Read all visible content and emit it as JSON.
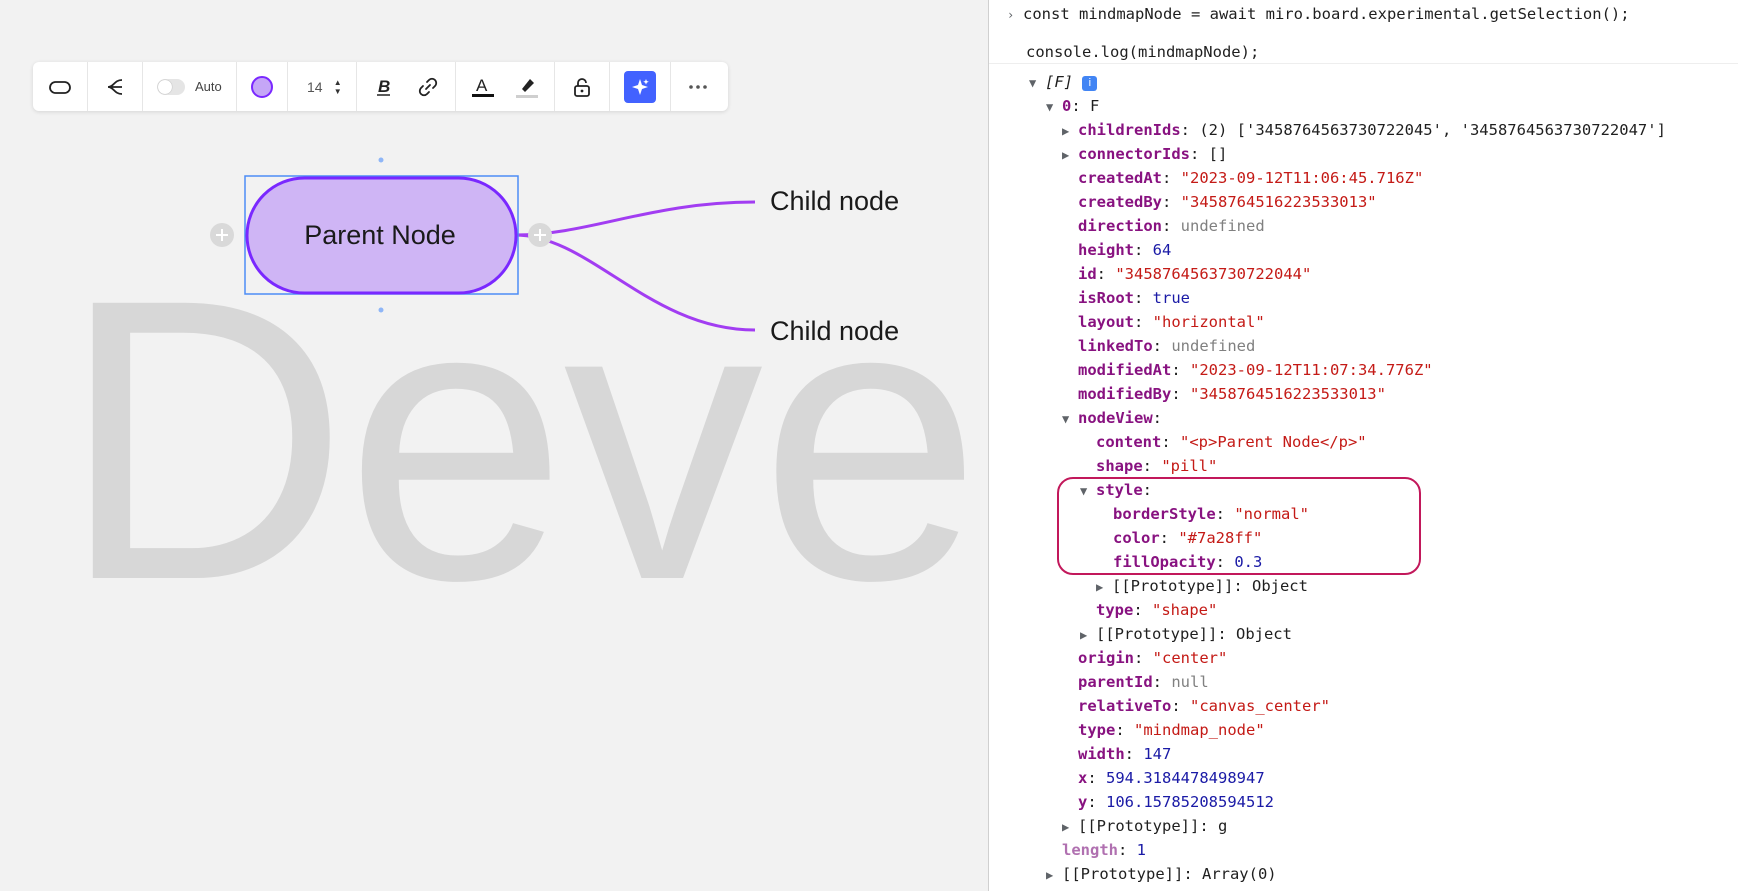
{
  "canvas": {
    "watermark": "Devel",
    "toolbar": {
      "auto_label": "Auto",
      "font_size": "14",
      "items": [
        "shape-icon",
        "mindmap-layout-icon",
        "auto-toggle",
        "color-picker",
        "font-size-stepper",
        "bold-icon",
        "link-icon",
        "text-color-icon",
        "highlighter-icon",
        "lock-icon",
        "ai-sparkle-icon",
        "more-icon"
      ]
    },
    "mindmap": {
      "parent_label": "Parent Node",
      "child_1_label": "Child node",
      "child_2_label": "Child node",
      "node_color": "#7a28ff",
      "node_fill": "#cfb5f5"
    }
  },
  "console": {
    "command_line_1": "const mindmapNode = await miro.board.experimental.getSelection();",
    "command_line_2": "console.log(mindmapNode);",
    "array_label": "[F]",
    "item_index": "0",
    "item_type": "F",
    "childrenIds": "(2) ['3458764563730722045', '3458764563730722047']",
    "connectorIds": "[]",
    "createdAt": "\"2023-09-12T11:06:45.716Z\"",
    "createdBy": "\"3458764516223533013\"",
    "direction": "undefined",
    "height": "64",
    "id": "\"3458764563730722044\"",
    "isRoot": "true",
    "layout": "\"horizontal\"",
    "linkedTo": "undefined",
    "modifiedAt": "\"2023-09-12T11:07:34.776Z\"",
    "modifiedBy": "\"3458764516223533013\"",
    "nodeView_content": "\"<p>Parent Node</p>\"",
    "nodeView_shape": "\"pill\"",
    "style_borderStyle": "\"normal\"",
    "style_color": "\"#7a28ff\"",
    "style_fillOpacity": "0.3",
    "prototype_object": "Object",
    "nodeView_type": "\"shape\"",
    "origin": "\"center\"",
    "parentId": "null",
    "relativeTo": "\"canvas_center\"",
    "type": "\"mindmap_node\"",
    "width": "147",
    "x": "594.3184478498947",
    "y": "106.15785208594512",
    "prototype_g": "g",
    "length": "1",
    "prototype_array": "Array(0)"
  }
}
